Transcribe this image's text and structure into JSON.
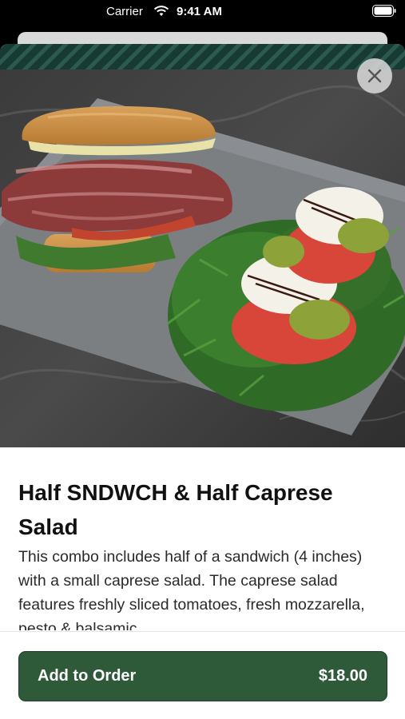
{
  "status_bar": {
    "carrier": "Carrier",
    "time": "9:41 AM"
  },
  "item": {
    "title": "Half SNDWCH & Half Caprese Salad",
    "description": "This combo includes half of a sandwich (4 inches) with a small caprese salad.  The caprese salad features freshly sliced tomatoes, fresh mozzarella, pesto & balsamic"
  },
  "footer": {
    "add_label": "Add to Order",
    "price": "$18.00"
  },
  "colors": {
    "accent": "#2e5a3a",
    "close_bg": "#d7d7d7"
  },
  "icons": {
    "close": "close-icon",
    "wifi": "wifi-icon",
    "battery": "battery-icon"
  }
}
